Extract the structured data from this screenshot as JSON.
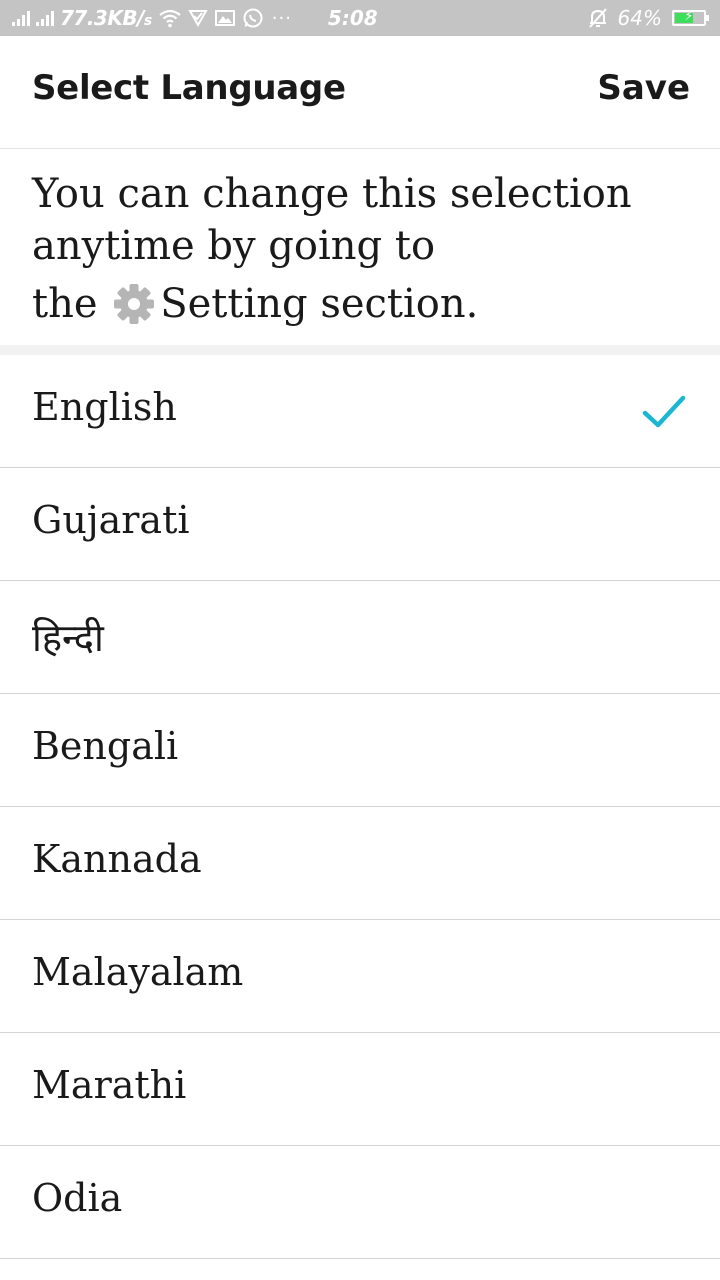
{
  "status_bar": {
    "network_speed": "77.3KB/",
    "network_speed_unit": "s",
    "more_indicator": "···",
    "time": "5:08",
    "battery_percent": "64%",
    "battery_level": 0.64,
    "battery_color": "#3dde5a",
    "icons": [
      "signal-icon",
      "signal-icon",
      "wifi-icon",
      "notification-icon",
      "gallery-icon",
      "whatsapp-icon",
      "silent-bell-icon",
      "battery-icon"
    ]
  },
  "header": {
    "title": "Select Language",
    "save_label": "Save"
  },
  "info": {
    "line1": "You can change this selection",
    "line2": "anytime by going to",
    "line3_prefix": "the",
    "line3_suffix": "Setting section.",
    "inline_icon": "gear-icon"
  },
  "languages": {
    "selected_color": "#1ab6d3",
    "items": [
      {
        "label": "English",
        "selected": true
      },
      {
        "label": "Gujarati",
        "selected": false
      },
      {
        "label": "हिन्दी",
        "selected": false
      },
      {
        "label": "Bengali",
        "selected": false
      },
      {
        "label": "Kannada",
        "selected": false
      },
      {
        "label": "Malayalam",
        "selected": false
      },
      {
        "label": "Marathi",
        "selected": false
      },
      {
        "label": "Odia",
        "selected": false
      }
    ]
  }
}
